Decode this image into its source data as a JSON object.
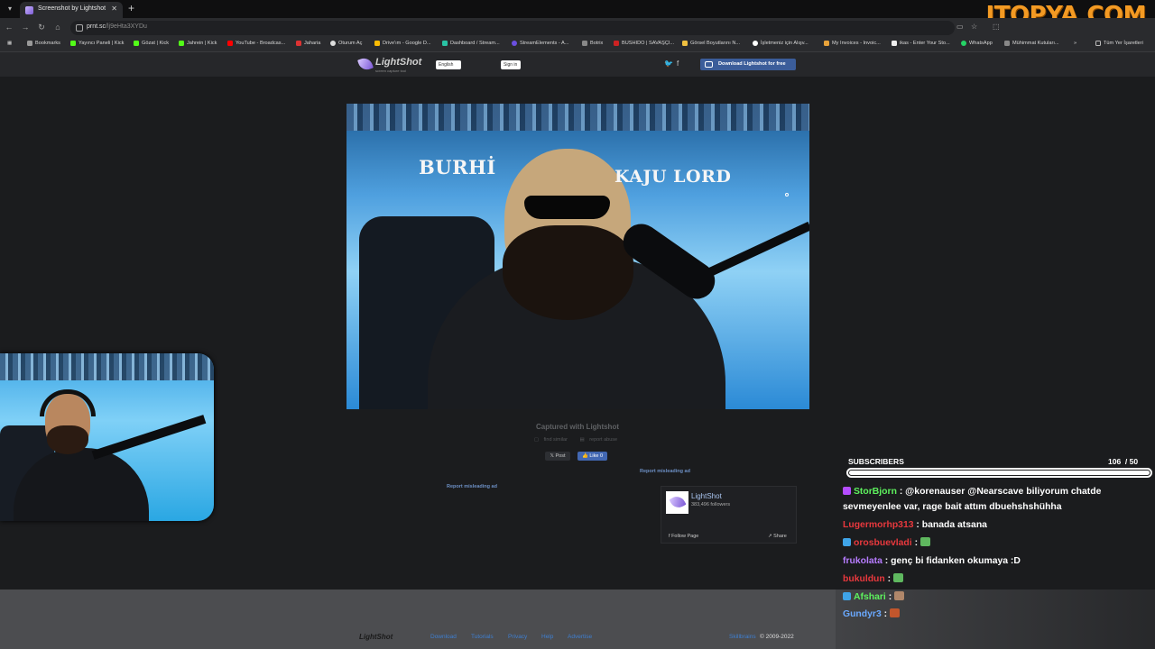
{
  "browser": {
    "tab_title": "Screenshot by Lightshot",
    "url_host": "prnt.sc",
    "url_path": "/lj9eHta3XYDu",
    "watermark": "ITOPYA.COM",
    "bookmarks": [
      {
        "label": "Bookmarks",
        "color": "#9a9a9a"
      },
      {
        "label": "Yayıncı Paneli | Kick",
        "color": "#53fc18"
      },
      {
        "label": "Gözat | Kick",
        "color": "#53fc18"
      },
      {
        "label": "Jahrein | Kick",
        "color": "#53fc18"
      },
      {
        "label": "YouTube - Broadcas...",
        "color": "#ff0000"
      },
      {
        "label": "Jaharia",
        "color": "#d33"
      },
      {
        "label": "Oturum Aç",
        "color": "#ddd"
      },
      {
        "label": "Drive'ım - Google D...",
        "color": "#fbbc04"
      },
      {
        "label": "Dashboard / Stream...",
        "color": "#29c2a4"
      },
      {
        "label": "StreamElements - A...",
        "color": "#6b4fe0"
      },
      {
        "label": "Botrix",
        "color": "#888"
      },
      {
        "label": "BUSHIDO | SAVAŞÇI...",
        "color": "#c22"
      },
      {
        "label": "Görsel Boyutlarını N...",
        "color": "#f0c040"
      },
      {
        "label": "İşletmeniz için Alışv...",
        "color": "#fff"
      },
      {
        "label": "My Invoices - Invoic...",
        "color": "#e8a33a"
      },
      {
        "label": "ikas - Enter Your Sto...",
        "color": "#eee"
      },
      {
        "label": "WhatsApp",
        "color": "#25d366"
      },
      {
        "label": "Mühimmat Kutuları...",
        "color": "#888"
      }
    ],
    "more_label": "»",
    "all_bookmarks_label": "Tüm Yer İşaretleri"
  },
  "lightshot": {
    "logo": "LightShot",
    "logo_sub": "screen capture tool",
    "language": "English",
    "sign_in": "Sign in",
    "download_label": "Download Lightshot for free",
    "screenshot_caption_left": "BURHİ",
    "screenshot_caption_right": "KAJU LORD",
    "captured_label": "Captured with Lightshot",
    "find_similar": "find similar",
    "report_abuse": "report abuse",
    "post_label": "Post",
    "like_label": "Like 0",
    "report_ad_1": "Report misleading ad",
    "report_ad_2": "Report misleading ad",
    "fb_page_name": "LightShot",
    "fb_followers": "383,496 followers",
    "fb_follow": "Follow Page",
    "fb_share": "Share",
    "footer_logo": "LightShot",
    "footer_links": [
      "Download",
      "Tutorials",
      "Privacy",
      "Help",
      "Advertise"
    ],
    "footer_company": "Skillbrains",
    "footer_copyright": "© 2009-2022"
  },
  "chat": {
    "subscribers_label": "SUBSCRIBERS",
    "subscribers_count": "106",
    "subscribers_goal": "/ 50",
    "subscribers_progress": 1.0,
    "messages": [
      {
        "user": "StorBjorn",
        "color": "#5ef25e",
        "badge": "#b44cff",
        "text": ": @korenauser @Nearscave biliyorum chatde sevmeyenlee var, rage bait attım dbuehshshühha"
      },
      {
        "user": "Lugermorhp313",
        "color": "#e8383d",
        "badge": "",
        "text": ": banada atsana"
      },
      {
        "user": "orosbuevladi",
        "color": "#e8383d",
        "badge": "#3fa4e8",
        "text": ":",
        "emote": "#5fb85f"
      },
      {
        "user": "frukolata",
        "color": "#b77cff",
        "badge": "",
        "text": ": genç bi fidanken okumaya :D"
      },
      {
        "user": "bukuldun",
        "color": "#e8383d",
        "badge": "",
        "text": ":",
        "emote": "#5fb85f"
      },
      {
        "user": "Afshari",
        "color": "#5ef25e",
        "badge": "#3fa4e8",
        "text": ":",
        "emote": "#b0876a"
      },
      {
        "user": "Gundyr3",
        "color": "#6aa9ff",
        "badge": "",
        "text": ":",
        "emote": "#c2562c"
      }
    ]
  }
}
